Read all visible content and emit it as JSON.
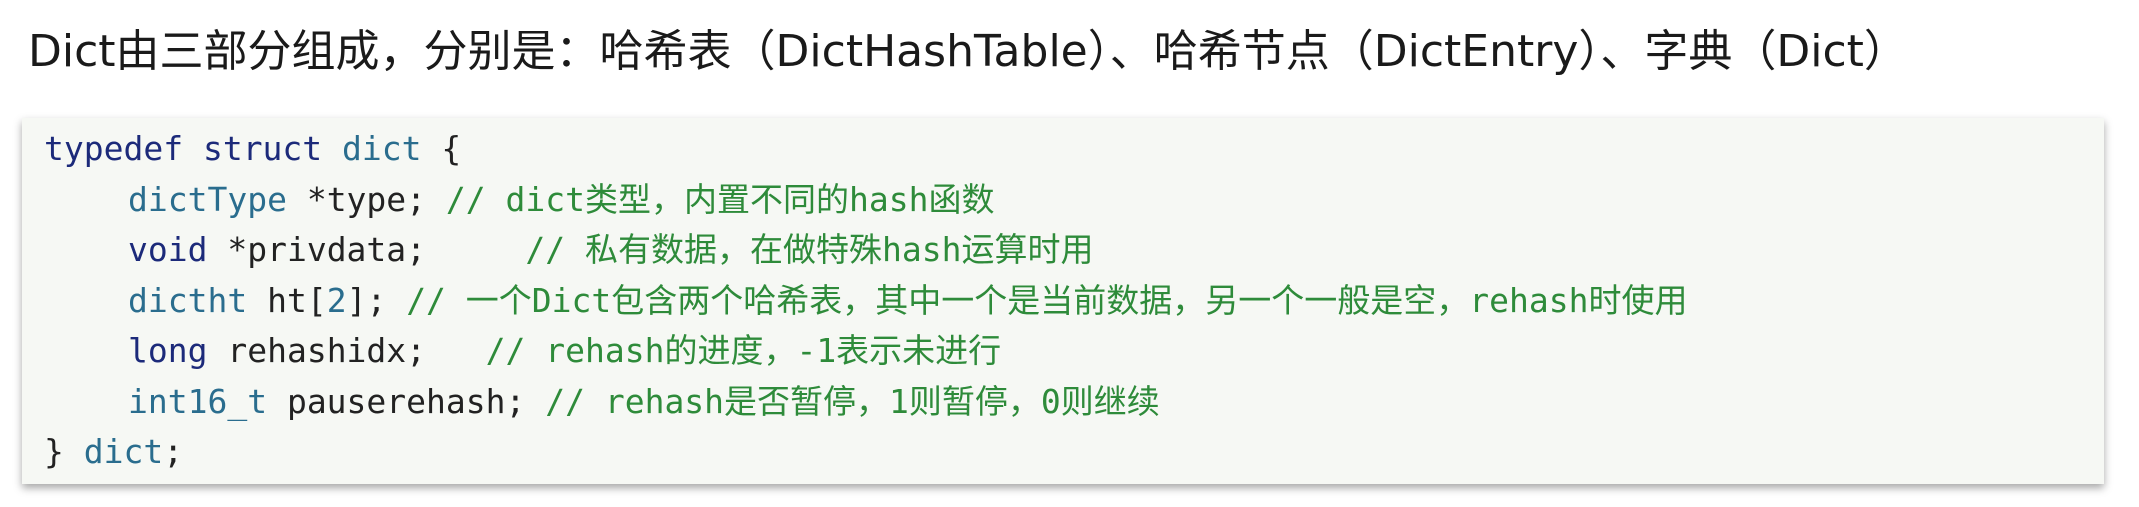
{
  "heading": "Dict由三部分组成，分别是：哈希表（DictHashTable）、哈希节点（DictEntry）、字典（Dict）",
  "code": {
    "line1": {
      "kw_typedef": "typedef",
      "kw_struct": "struct",
      "name": "dict",
      "brace": " {"
    },
    "line2": {
      "type": "dictType",
      "rest": " *type; ",
      "comment": "// dict类型，内置不同的hash函数"
    },
    "line3": {
      "type": "void",
      "rest": " *privdata;     ",
      "comment": "// 私有数据，在做特殊hash运算时用"
    },
    "line4": {
      "type": "dictht",
      "rest1": " ht[",
      "num": "2",
      "rest2": "]; ",
      "comment": "// 一个Dict包含两个哈希表，其中一个是当前数据，另一个一般是空，rehash时使用"
    },
    "line5": {
      "type": "long",
      "rest": " rehashidx;   ",
      "comment": "// rehash的进度，-1表示未进行"
    },
    "line6": {
      "type": "int16_t",
      "rest": " pauserehash; ",
      "comment": "// rehash是否暂停，1则暂停，0则继续"
    },
    "line7": {
      "close": "} ",
      "name": "dict",
      "semi": ";"
    }
  }
}
